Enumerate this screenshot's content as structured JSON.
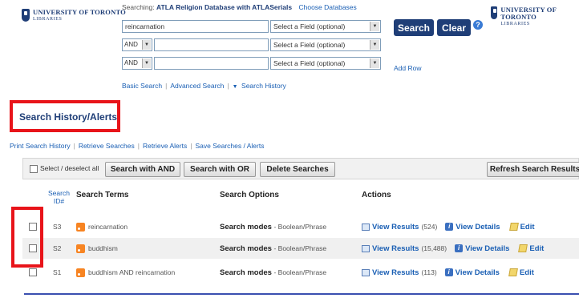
{
  "logo_left": {
    "line1": "UNIVERSITY OF TORONTO",
    "line2": "LIBRARIES"
  },
  "logo_right": {
    "line1": "UNIVERSITY OF TORONTO",
    "line2": "LIBRARIES"
  },
  "search": {
    "searching_label": "Searching:",
    "database": "ATLA Religion Database with ATLASerials",
    "choose_databases": "Choose Databases",
    "row1_value": "reincarnation",
    "field_placeholder": "Select a Field (optional)",
    "op_value": "AND",
    "search_button": "Search",
    "clear_button": "Clear",
    "help_icon": "?",
    "add_row": "Add Row",
    "links": {
      "basic": "Basic Search",
      "advanced": "Advanced Search",
      "history": "Search History"
    }
  },
  "history": {
    "title": "Search History/Alerts",
    "links": {
      "print": "Print Search History",
      "retrieve_searches": "Retrieve Searches",
      "retrieve_alerts": "Retrieve Alerts",
      "save": "Save Searches / Alerts"
    },
    "toolbar": {
      "select_label": "Select / deselect all",
      "with_and": "Search with AND",
      "with_or": "Search with OR",
      "delete": "Delete Searches",
      "refresh": "Refresh Search Results"
    },
    "columns": {
      "id_line1": "Search",
      "id_line2": "ID#",
      "terms": "Search Terms",
      "options": "Search Options",
      "actions": "Actions"
    },
    "rows": [
      {
        "id": "S3",
        "terms": "reincarnation",
        "mode_label": "Search modes",
        "mode_value": "- Boolean/Phrase",
        "view_results": "View Results",
        "count": "(524)",
        "view_details": "View Details",
        "edit": "Edit"
      },
      {
        "id": "S2",
        "terms": "buddhism",
        "mode_label": "Search modes",
        "mode_value": "- Boolean/Phrase",
        "view_results": "View Results",
        "count": "(15,488)",
        "view_details": "View Details",
        "edit": "Edit"
      },
      {
        "id": "S1",
        "terms": "buddhism AND reincarnation",
        "mode_label": "Search modes",
        "mode_value": "- Boolean/Phrase",
        "view_results": "View Results",
        "count": "(113)",
        "view_details": "View Details",
        "edit": "Edit"
      }
    ]
  },
  "icons": [
    "crest-icon",
    "help-icon",
    "dropdown-arrow-icon",
    "rss-icon",
    "view-results-icon",
    "info-icon",
    "edit-icon"
  ],
  "colors": {
    "brand": "#1f3e77",
    "link": "#1a5fb4",
    "highlight": "#e8141a",
    "rss": "#f78422"
  }
}
